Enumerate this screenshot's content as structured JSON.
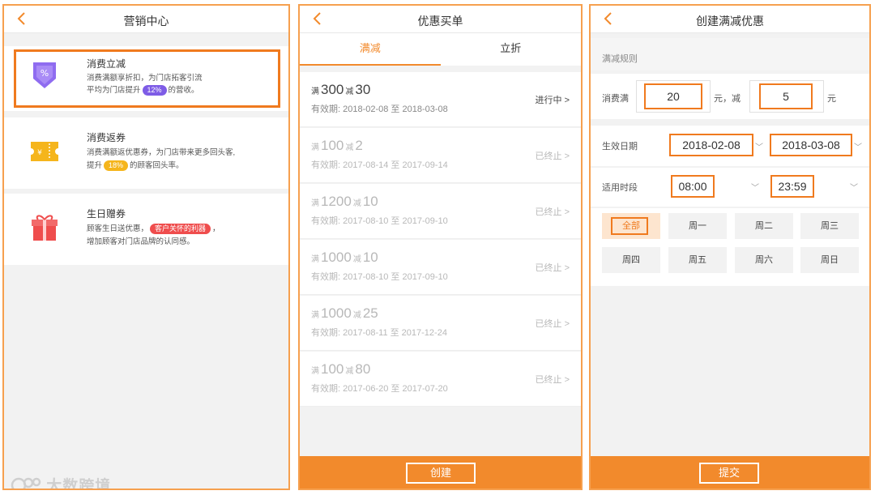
{
  "screen1": {
    "title": "营销中心",
    "cards": [
      {
        "title": "消费立减",
        "line1": "消费满额享折扣，为门店拓客引流",
        "line2_pre": "平均为门店提升",
        "line2_pill": "12%",
        "line2_post": "的营收。",
        "pill_color": "#7e5ce6",
        "icon": "discount-badge-icon"
      },
      {
        "title": "消费返券",
        "line1": "消费满额返优惠券，为门店带来更多回头客,",
        "line2_pre": "提升",
        "line2_pill": "18%",
        "line2_post": "的顾客回头率。",
        "pill_color": "#f5b51c",
        "icon": "ticket-icon"
      },
      {
        "title": "生日赠券",
        "line1_pre": "顾客生日送优惠，",
        "line1_pill": "客户关怀的利器",
        "line1_post": "，",
        "line2": "增加顾客对门店品牌的认同感。",
        "pill_color": "#ef4d4d",
        "icon": "gift-icon"
      }
    ]
  },
  "screen2": {
    "title": "优惠买单",
    "tabs": [
      "满减",
      "立折"
    ],
    "coupons": [
      {
        "man": "满",
        "full": "300",
        "jian": "减",
        "minus": "30",
        "valid": "有效期: 2018-02-08 至 2018-03-08",
        "status": "进行中 >"
      },
      {
        "man": "满",
        "full": "100",
        "jian": "减",
        "minus": "2",
        "valid": "有效期: 2017-08-14 至 2017-09-14",
        "status": "已终止 >"
      },
      {
        "man": "满",
        "full": "1200",
        "jian": "减",
        "minus": "10",
        "valid": "有效期: 2017-08-10 至 2017-09-10",
        "status": "已终止 >"
      },
      {
        "man": "满",
        "full": "1000",
        "jian": "减",
        "minus": "10",
        "valid": "有效期: 2017-08-10 至 2017-09-10",
        "status": "已终止 >"
      },
      {
        "man": "满",
        "full": "1000",
        "jian": "减",
        "minus": "25",
        "valid": "有效期: 2017-08-11 至 2017-12-24",
        "status": "已终止 >"
      },
      {
        "man": "满",
        "full": "100",
        "jian": "减",
        "minus": "80",
        "valid": "有效期: 2017-06-20 至 2017-07-20",
        "status": "已终止 >"
      }
    ],
    "create_label": "创建"
  },
  "screen3": {
    "title": "创建满减优惠",
    "section_title": "满减规则",
    "spend_label": "消费满",
    "spend_value": "20",
    "mid_label": "元，减",
    "minus_value": "5",
    "unit_label": "元",
    "date_label": "生效日期",
    "start_date": "2018-02-08",
    "end_date": "2018-03-08",
    "time_label": "适用时段",
    "start_time": "08:00",
    "end_time": "23:59",
    "days": [
      "全部",
      "周一",
      "周二",
      "周三",
      "周四",
      "周五",
      "周六",
      "周日"
    ],
    "submit_label": "提交"
  },
  "watermark": "大数跨境",
  "colors": {
    "accent": "#f28a2c",
    "highlight": "#f07a1e"
  }
}
